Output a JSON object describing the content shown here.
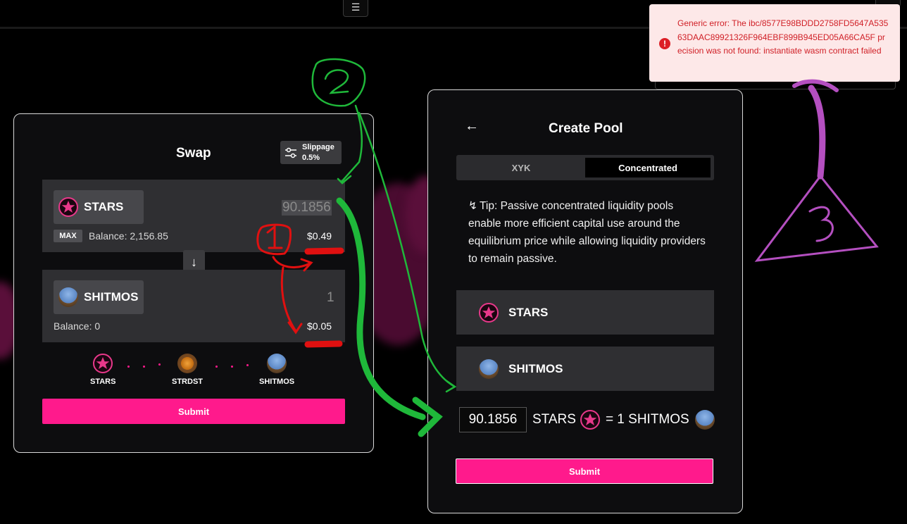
{
  "header": {
    "menu_icon": "hamburger-icon"
  },
  "swap": {
    "title": "Swap",
    "slippage_label": "Slippage",
    "slippage_value": "0.5%",
    "from": {
      "token": "STARS",
      "amount": "90.1856",
      "max_label": "MAX",
      "balance": "Balance: 2,156.85",
      "usd": "$0.49"
    },
    "to": {
      "token": "SHITMOS",
      "amount": "1",
      "balance": "Balance: 0",
      "usd": "$0.05"
    },
    "route": [
      "STARS",
      "STRDST",
      "SHITMOS"
    ],
    "submit_label": "Submit"
  },
  "pool": {
    "title": "Create Pool",
    "tabs": [
      "XYK",
      "Concentrated"
    ],
    "active_tab": "Concentrated",
    "tip": "Tip: Passive concentrated liquidity pools enable more efficient capital use around the equilibrium price while allowing liquidity providers to remain passive.",
    "tokens": [
      "STARS",
      "SHITMOS"
    ],
    "ratio_value": "90.1856",
    "ratio_base": "STARS",
    "ratio_eq": "= 1 SHITMOS",
    "submit_label": "Submit"
  },
  "toast": {
    "message": "Generic error: The ibc/8577E98BDDD2758FD5647A53563DAAC89921326F964EBF899B945ED05A66CA5F precision was not found: instantiate wasm contract failed"
  },
  "annotations": {
    "one": "1",
    "two": "2",
    "three": "3"
  },
  "colors": {
    "accent": "#ff1a8c",
    "error": "#d01f26",
    "annotation_green": "#1fb83a",
    "annotation_red": "#e01010",
    "annotation_purple": "#b44fc0"
  }
}
